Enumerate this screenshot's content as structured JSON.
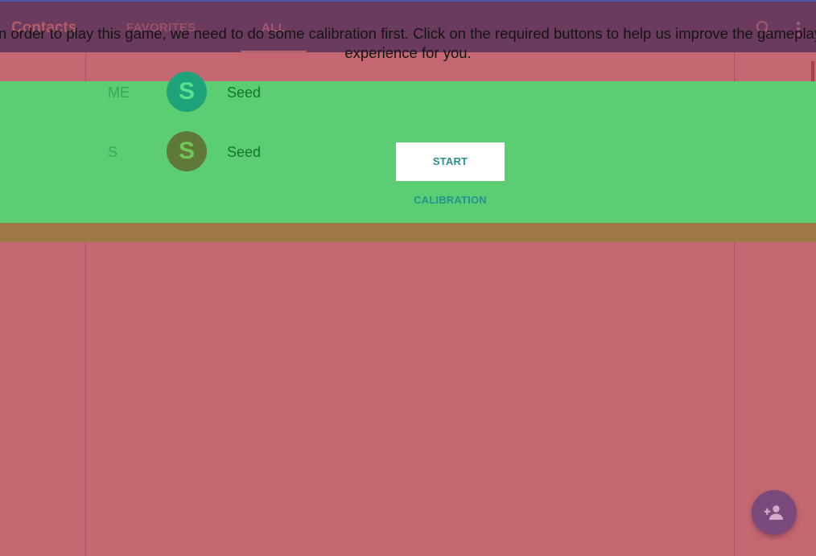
{
  "app": {
    "title": "Contacts",
    "tabs": [
      {
        "label": "FAVORITES"
      },
      {
        "label": "ALL"
      }
    ],
    "icons": {
      "search": "search-icon",
      "more": "more-vert-icon",
      "fab": "add-person-icon"
    }
  },
  "contacts": [
    {
      "section": "ME",
      "initial": "S",
      "name": "Seed"
    },
    {
      "section": "S",
      "initial": "S",
      "name": "Seed"
    }
  ],
  "calibration": {
    "message": "In order to play this game, we need to do some calibration first. Click on the required buttons to help us improve the gameplay experience for you.",
    "button_label": "START CALIBRATION"
  },
  "colors": {
    "overlay_red": "#c46771",
    "calibration_green": "#5bce74",
    "appbar": "#6a3a5f",
    "button_text": "#2a8f8e"
  }
}
